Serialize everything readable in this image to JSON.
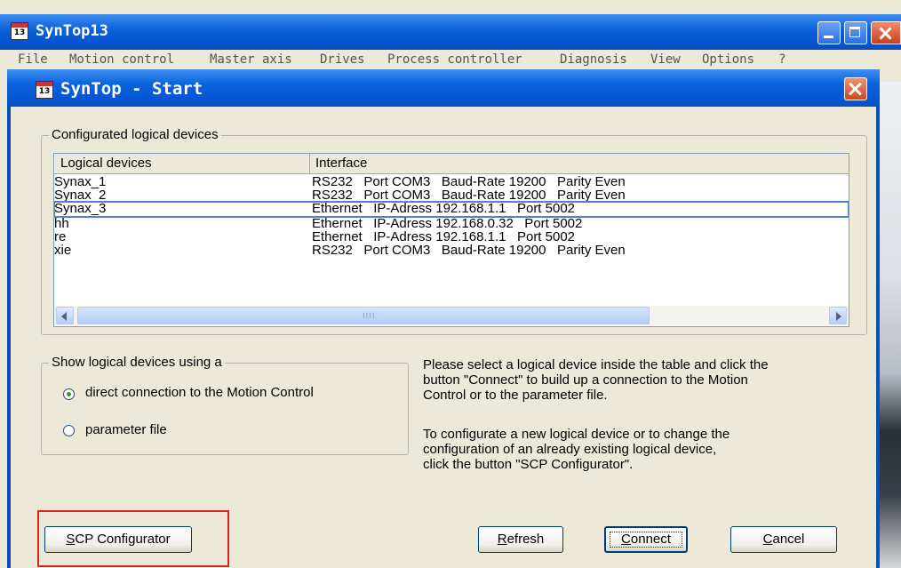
{
  "main_window": {
    "title": "SynTop13",
    "icon_label": "13",
    "menu": [
      "File",
      "Motion control",
      "Master axis",
      "Drives",
      "Process controller",
      "Diagnosis",
      "View",
      "Options",
      "?"
    ]
  },
  "dialog": {
    "title": "SynTop - Start",
    "icon_label": "13"
  },
  "devices_group": {
    "legend": "Configurated logical devices",
    "columns": [
      "Logical devices",
      "Interface"
    ],
    "rows": [
      {
        "device": "Synax_1",
        "interface": "RS232   Port COM3   Baud-Rate 19200   Parity Even"
      },
      {
        "device": "Synax_2",
        "interface": "RS232   Port COM3   Baud-Rate 19200   Parity Even"
      },
      {
        "device": "Synax_3",
        "interface": "Ethernet   IP-Adress 192.168.1.1   Port 5002"
      },
      {
        "device": "hh",
        "interface": "Ethernet   IP-Adress 192.168.0.32   Port 5002"
      },
      {
        "device": "re",
        "interface": "Ethernet   IP-Adress 192.168.1.1   Port 5002"
      },
      {
        "device": "xie",
        "interface": "RS232   Port COM3   Baud-Rate 19200   Parity Even"
      }
    ],
    "selected_row": "Synax_3",
    "scroll_grip": "IIII"
  },
  "show_group": {
    "legend": "Show logical devices using a",
    "options": [
      {
        "label": "direct connection to the Motion Control",
        "checked": true
      },
      {
        "label": "parameter file",
        "checked": false
      }
    ]
  },
  "instructions": {
    "lines": [
      "Please select a logical device inside the table and click the",
      "button \"Connect\" to build up a connection to the Motion",
      "Control or to the parameter file.",
      "To configurate a new logical device or to change the",
      "configuration of an already existing logical device,",
      "click the button \"SCP Configurator\"."
    ]
  },
  "buttons": {
    "scp_prefix": "S",
    "scp_rest": "CP Configurator",
    "refresh_prefix": "R",
    "refresh_rest": "efresh",
    "connect_prefix": "C",
    "connect_rest": "onnect",
    "cancel_prefix": "C",
    "cancel_rest": "ancel"
  },
  "colors": {
    "title_bar": "#0a5fd8",
    "highlight": "#e02020",
    "selection": "#4f7fd0"
  }
}
